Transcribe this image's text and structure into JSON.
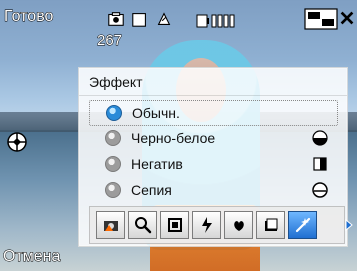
{
  "status": {
    "ready_text": "Готово",
    "shots_remaining": "267"
  },
  "top_icons": [
    {
      "name": "camera-mode-icon"
    },
    {
      "name": "flash-mode-icon"
    },
    {
      "name": "exposure-icon"
    },
    {
      "name": "battery-icon"
    },
    {
      "name": "resolution-icon"
    },
    {
      "name": "close-icon"
    }
  ],
  "effect_panel": {
    "title": "Эффект",
    "options": [
      {
        "label": "Обычн.",
        "selected": true,
        "preview": ""
      },
      {
        "label": "Черно-белое",
        "selected": false,
        "preview": "circle-half-dark"
      },
      {
        "label": "Негатив",
        "selected": false,
        "preview": "square-invert"
      },
      {
        "label": "Сепия",
        "selected": false,
        "preview": "circle-outline"
      }
    ]
  },
  "toolbar": {
    "buttons": [
      {
        "name": "camera-settings-icon",
        "active": false
      },
      {
        "name": "zoom-icon",
        "active": false
      },
      {
        "name": "frame-icon",
        "active": false
      },
      {
        "name": "flash-icon",
        "active": false
      },
      {
        "name": "macro-icon",
        "active": false
      },
      {
        "name": "gallery-icon",
        "active": false
      },
      {
        "name": "effects-icon",
        "active": true
      }
    ]
  },
  "bottom_bar": {
    "cancel_label": "Отмена"
  },
  "colors": {
    "accent_blue": "#1f6fd1",
    "panel_bg": "#f6f6f6"
  }
}
